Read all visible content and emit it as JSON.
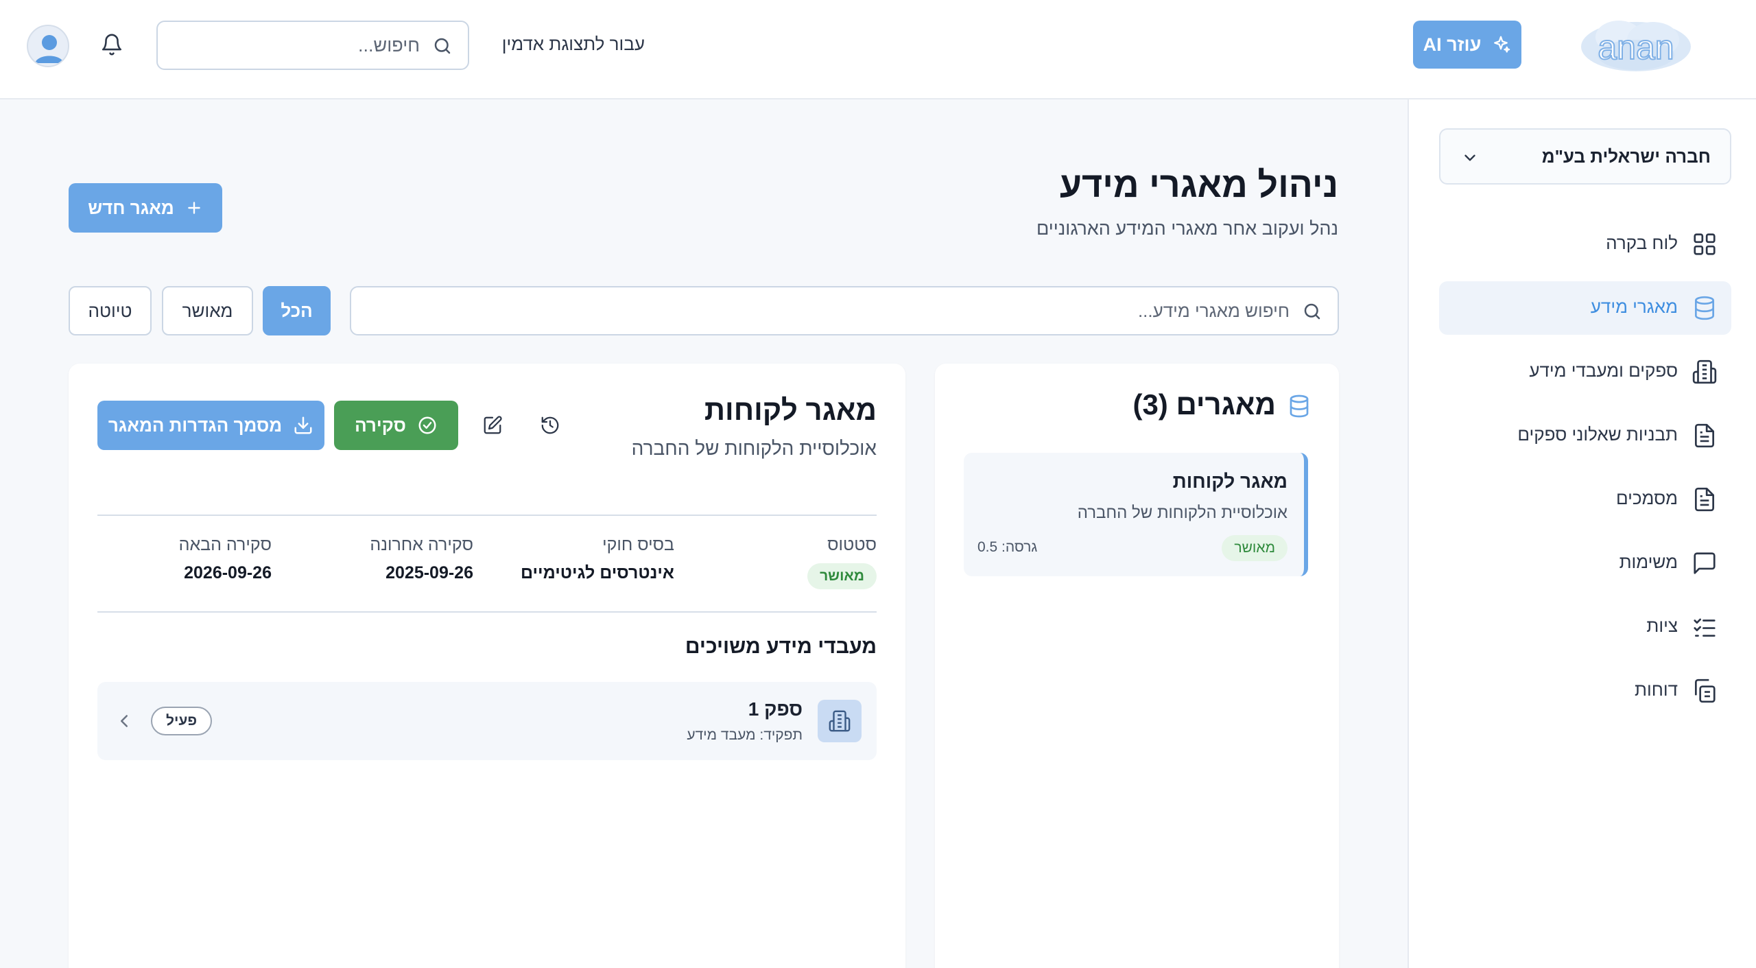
{
  "header": {
    "search_placeholder": "חיפוש...",
    "admin_link": "עבור לתצוגת אדמין",
    "ai_button": "עוזר AI",
    "logo_text": "anan",
    "icons": {
      "avatar": "user-avatar-icon",
      "bell": "bell-icon",
      "search": "search-icon",
      "ai": "sparkle-icon"
    }
  },
  "sidebar": {
    "company": "חברה ישראלית בע\"מ",
    "items": [
      {
        "label": "לוח בקרה",
        "icon": "grid-icon",
        "active": false
      },
      {
        "label": "מאגרי מידע",
        "icon": "database-icon",
        "active": true
      },
      {
        "label": "ספקים ומעבדי מידע",
        "icon": "building-icon",
        "active": false
      },
      {
        "label": "תבניות שאלוני ספקים",
        "icon": "file-text-icon",
        "active": false
      },
      {
        "label": "מסמכים",
        "icon": "document-icon",
        "active": false
      },
      {
        "label": "משימות",
        "icon": "message-square-icon",
        "active": false
      },
      {
        "label": "ציות",
        "icon": "checklist-icon",
        "active": false
      },
      {
        "label": "דוחות",
        "icon": "copy-icon",
        "active": false
      }
    ]
  },
  "main": {
    "title": "ניהול מאגרי מידע",
    "subtitle": "נהל ועקוב אחר מאגרי המידע הארגוניים",
    "new_button": "מאגר חדש",
    "search_placeholder": "חיפוש מאגרי מידע...",
    "filters": [
      {
        "label": "הכל",
        "active": true
      },
      {
        "label": "מאושר",
        "active": false
      },
      {
        "label": "טיוטה",
        "active": false
      }
    ],
    "list": {
      "title": "מאגרים (3)",
      "items": [
        {
          "name": "מאגר לקוחות",
          "description": "אוכלוסיית הלקוחות של החברה",
          "status": "מאושר",
          "version": "גרסה: 0.5"
        }
      ]
    },
    "detail": {
      "name": "מאגר לקוחות",
      "description": "אוכלוסיית הלקוחות של החברה",
      "review_button": "סקירה",
      "doc_button": "מסמך הגדרות המאגר",
      "meta": {
        "status_label": "סטטוס",
        "status_value": "מאושר",
        "legal_label": "בסיס חוקי",
        "legal_value": "אינטרסים לגיטימיים",
        "last_label": "סקירה אחרונה",
        "last_value": "2025-09-26",
        "next_label": "סקירה הבאה",
        "next_value": "2026-09-26"
      },
      "processors_title": "מעבדי מידע משויכים",
      "processors": [
        {
          "name": "ספק 1",
          "role": "תפקיד: מעבד מידע",
          "status": "פעיל"
        }
      ]
    }
  },
  "colors": {
    "accent": "#6aa6e6",
    "accent_text": "#3d8de0",
    "success": "#4a9e56",
    "badge_bg": "#e6f5e8",
    "badge_text": "#2f8a3c"
  }
}
